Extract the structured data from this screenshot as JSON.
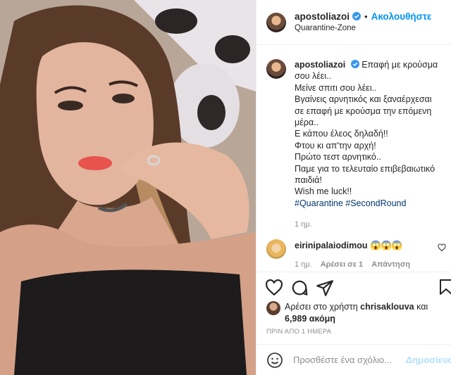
{
  "photo": {
    "description_icon": "selfie-photo"
  },
  "header": {
    "username": "apostoliazoi",
    "separator": "•",
    "follow_label": "Ακολουθήστε",
    "location": "Quarantine-Zone"
  },
  "caption": {
    "username": "apostoliazoi",
    "lines": [
      "Επαφή με κρούσμα",
      "σου λέει..",
      "Μείνε σπιτι σου λέει..",
      "Βγαίνεις αρνητικός και ξαναέρχεσαι",
      "σε επαφή με κρούσμα την επόμενη",
      "μέρα..",
      "Ε κάπου έλεος δηλαδή!!",
      "Φτου κι απ'την αρχή!",
      "Πρώτο τεστ αρνητικό..",
      "Παμε για το τελευταίο επιβεβαιωτικό",
      "παιδιά!",
      "Wish me luck!!"
    ],
    "hashtags": "#Quarantine #SecondRound",
    "time": "1 ημ."
  },
  "comment": {
    "username": "eirinipalaiodimou",
    "text": "😱😱😱",
    "time": "1 ημ.",
    "likes": "Αρέσει σε 1",
    "reply": "Απάντηση"
  },
  "likes": {
    "prefix": "Αρέσει στο χρήστη",
    "user": "chrisaklouva",
    "connector": "και",
    "others": "6,989 ακόμη"
  },
  "timestamp": "ΠΡΙΝ ΑΠΟ 1 ΗΜΕΡΑ",
  "add_comment": {
    "placeholder": "Προσθέστε ένα σχόλιο...",
    "post_label": "Δημοσίευση"
  },
  "colors": {
    "accent": "#0095f6",
    "verified": "#3897f0",
    "muted": "#8e8e8e"
  }
}
